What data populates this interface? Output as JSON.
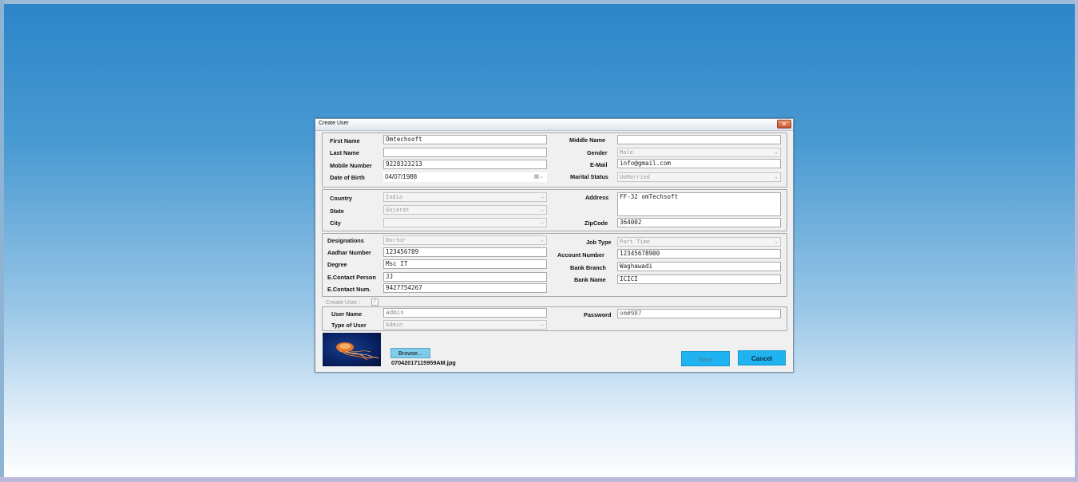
{
  "window": {
    "title": "Create User",
    "close_symbol": "✕"
  },
  "personal": {
    "first_name_label": "First Name",
    "first_name_value": "Omtechsoft",
    "middle_name_label": "Middle Name",
    "middle_name_value": "",
    "last_name_label": "Last Name",
    "last_name_value": "",
    "gender_label": "Gender",
    "gender_value": "Male",
    "mobile_label": "Mobile Number",
    "mobile_value": "9228323213",
    "email_label": "E-Mail",
    "email_value": "info@gmail.com",
    "dob_label": "Date of Birth",
    "dob_value": "04/07/1988",
    "marital_label": "Marital Status",
    "marital_value": "UnMarried"
  },
  "address": {
    "country_label": "Country",
    "country_value": "India",
    "state_label": "State",
    "state_value": "Gujarat",
    "city_label": "City",
    "city_value": "",
    "address_label": "Address",
    "address_value": "FF-32 omTechsoft",
    "zipcode_label": "ZipCode",
    "zipcode_value": "364002"
  },
  "professional": {
    "designation_label": "Designations",
    "designation_value": "Doctor",
    "aadhar_label": "Aadhar Number",
    "aadhar_value": "123456789",
    "degree_label": "Degree",
    "degree_value": "Msc IT",
    "econtact_person_label": "E.Contact Person",
    "econtact_person_value": "JJ",
    "econtact_num_label": "E.Contact Num.",
    "econtact_num_value": "9427754267",
    "jobtype_label": "Job Type",
    "jobtype_value": "Part Time",
    "account_label": "Account Number",
    "account_value": "12345678900",
    "bank_branch_label": "Bank Branch",
    "bank_branch_value": "Waghawadi",
    "bank_name_label": "Bank Name",
    "bank_name_value": "ICICI"
  },
  "user": {
    "create_user_label": "Create User :",
    "create_user_checked": "✓",
    "username_label": "User Name",
    "username_value": "admin",
    "type_label": "Type of User",
    "type_value": "Admin",
    "password_label": "Password",
    "password_value": "om#987"
  },
  "photo": {
    "browse_label": "Browse...",
    "filename": "07042017115959AM.jpg"
  },
  "actions": {
    "save_label": "Save",
    "cancel_label": "Cancel"
  },
  "icons": {
    "dropdown_arrow": "⌄",
    "calendar": "▦⌄"
  }
}
